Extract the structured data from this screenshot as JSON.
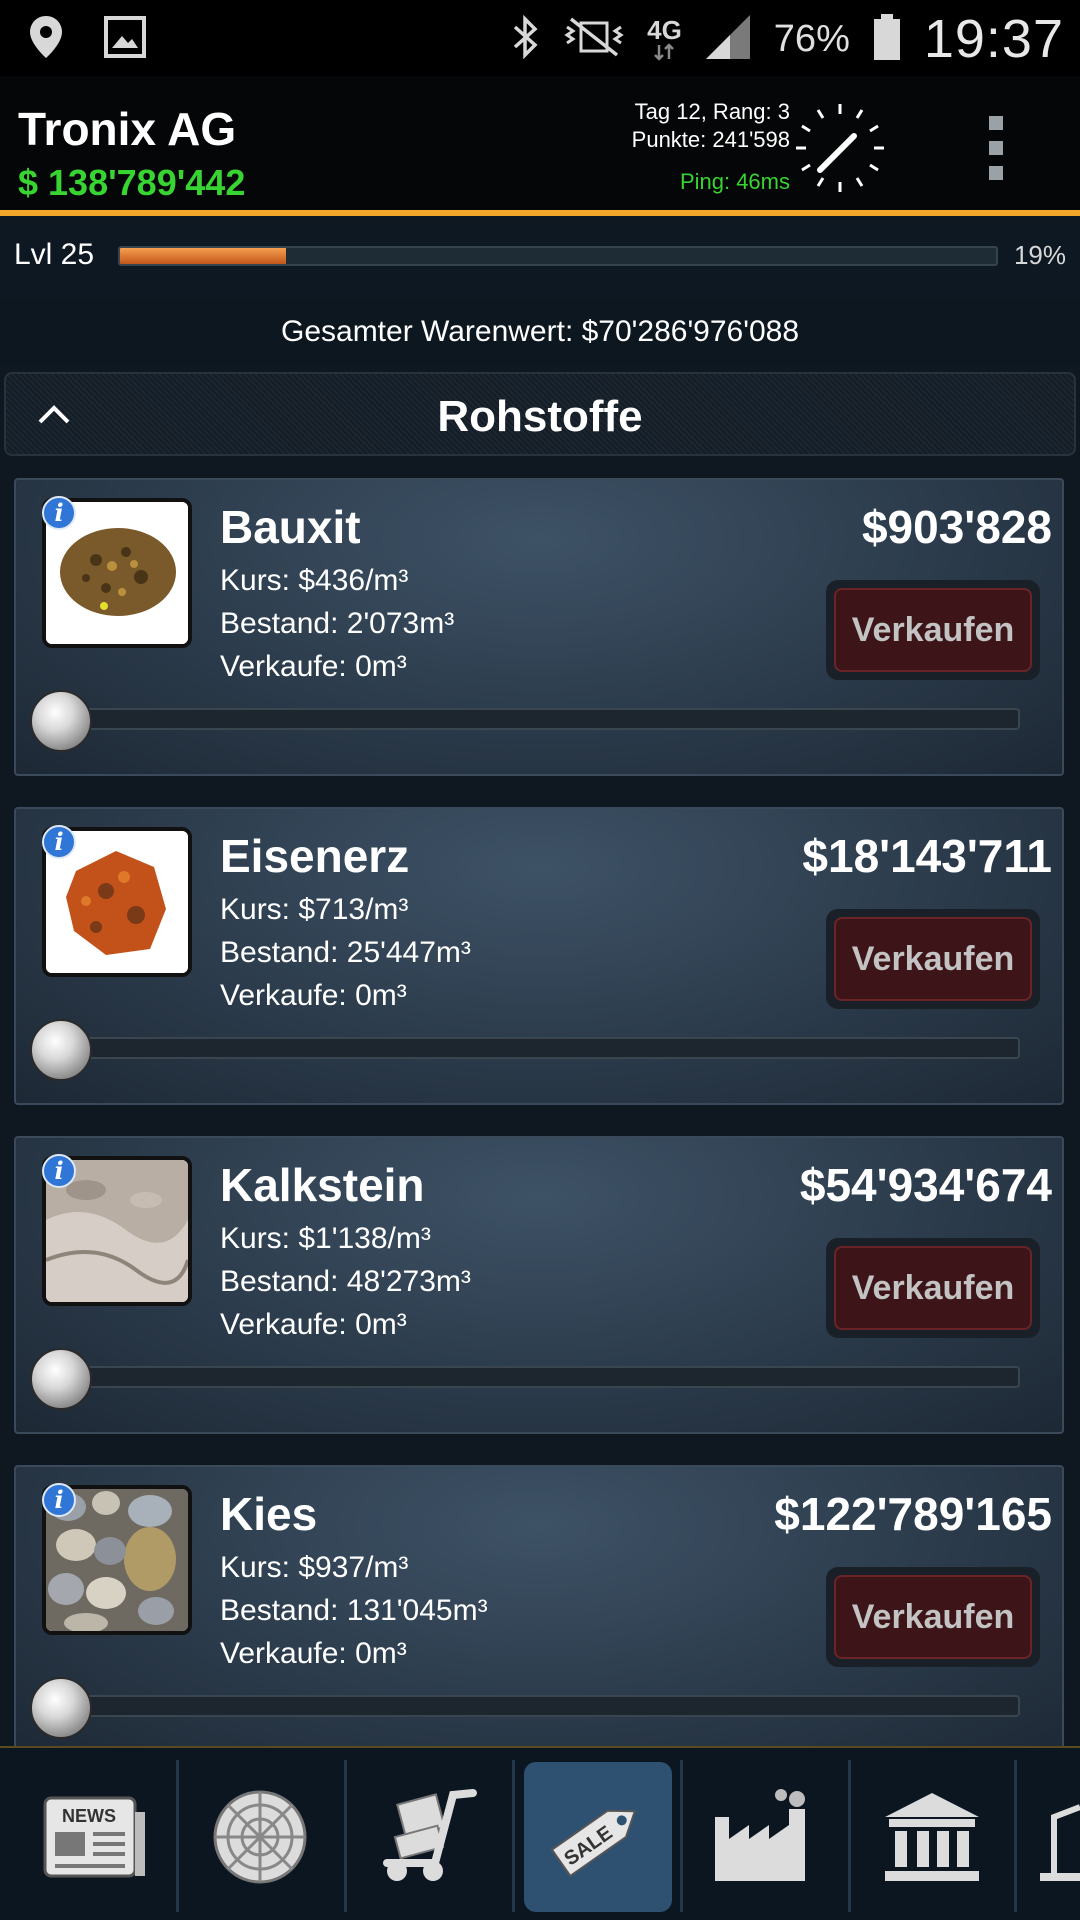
{
  "status_bar": {
    "icons_left": [
      "location-icon",
      "image-icon"
    ],
    "icons_right": [
      "bluetooth-icon",
      "vibrate-icon",
      "network-4g-icon",
      "signal-icon",
      "battery-icon"
    ],
    "network": "4G",
    "battery_percent": "76%",
    "time": "19:37"
  },
  "header": {
    "company": "Tronix AG",
    "money": "$ 138'789'442",
    "day_rank": "Tag 12, Rang: 3",
    "points": "Punkte: 241'598",
    "ping": "Ping: 46ms",
    "icons": [
      "clock-icon",
      "overflow-menu-icon"
    ]
  },
  "level": {
    "label": "Lvl 25",
    "progress_fraction": 0.19,
    "percent_text": "19%"
  },
  "total_value": "Gesamter Warenwert: $70'286'976'088",
  "section": {
    "title": "Rohstoffe",
    "icon": "chevron-up-icon"
  },
  "items": [
    {
      "name": "Bauxit",
      "kurs": "Kurs: $436/m³",
      "bestand": "Bestand: 2'073m³",
      "verkaufe": "Verkaufe: 0m³",
      "value": "$903'828",
      "sell_label": "Verkaufen",
      "image": "bauxite-rock",
      "slider_fraction": 0
    },
    {
      "name": "Eisenerz",
      "kurs": "Kurs: $713/m³",
      "bestand": "Bestand: 25'447m³",
      "verkaufe": "Verkaufe: 0m³",
      "value": "$18'143'711",
      "sell_label": "Verkaufen",
      "image": "iron-ore-rock",
      "slider_fraction": 0
    },
    {
      "name": "Kalkstein",
      "kurs": "Kurs: $1'138/m³",
      "bestand": "Bestand: 48'273m³",
      "verkaufe": "Verkaufe: 0m³",
      "value": "$54'934'674",
      "sell_label": "Verkaufen",
      "image": "limestone",
      "slider_fraction": 0
    },
    {
      "name": "Kies",
      "kurs": "Kurs: $937/m³",
      "bestand": "Bestand: 131'045m³",
      "verkaufe": "Verkaufe: 0m³",
      "value": "$122'789'165",
      "sell_label": "Verkaufen",
      "image": "gravel-pebbles",
      "slider_fraction": 0
    }
  ],
  "bottom_nav": {
    "news_label": "NEWS",
    "sale_label": "SALE",
    "icons": [
      "news-icon",
      "radar-icon",
      "hand-truck-icon",
      "sale-tag-icon",
      "factory-icon",
      "bank-icon",
      "crane-icon"
    ],
    "active": "sale-tag-icon"
  },
  "colors": {
    "accent_orange": "#f2a62a",
    "money_green": "#38d432",
    "sell_button": "#3d1519",
    "active_tab": "#2e5172"
  }
}
